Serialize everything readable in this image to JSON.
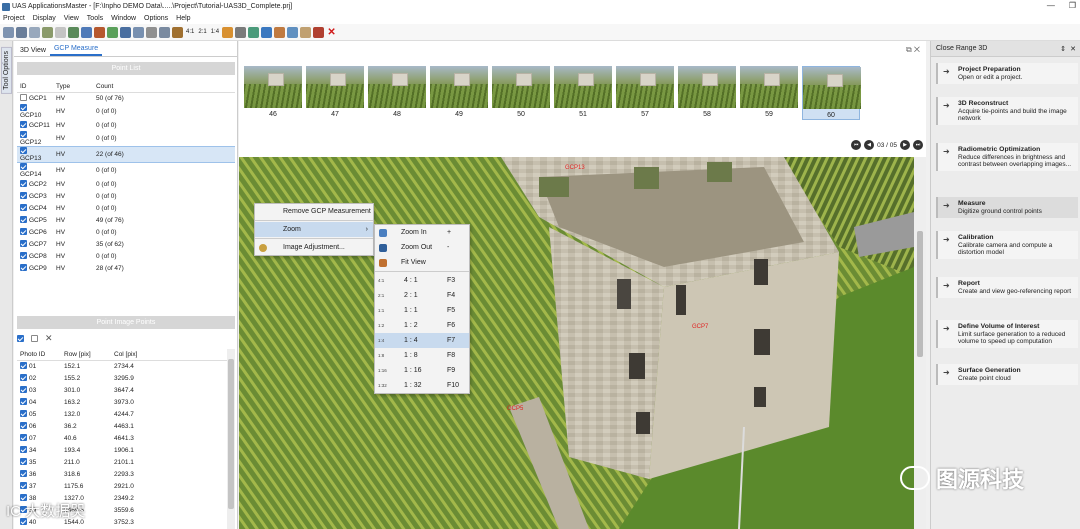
{
  "window": {
    "title": "UAS ApplicationsMaster - [F:\\Inpho DEMO Data\\.....\\Project\\Tutorial-UAS3D_Complete.prj]"
  },
  "menu": [
    "Project",
    "Display",
    "View",
    "Tools",
    "Window",
    "Options",
    "Help"
  ],
  "toolbar": {
    "ratio_labels": [
      "4:1",
      "2:1",
      "1:4"
    ]
  },
  "side_tab": "Tool Options",
  "left_tabs": [
    "3D View",
    "GCP Measure"
  ],
  "point_list": {
    "header": "Point List",
    "columns": [
      "ID",
      "Type",
      "Count"
    ],
    "rows": [
      {
        "id": "GCP1",
        "type": "HV",
        "count": "50 (of 76)",
        "checked": false
      },
      {
        "id": "GCP10",
        "type": "HV",
        "count": "0 (of 0)",
        "checked": true
      },
      {
        "id": "GCP11",
        "type": "HV",
        "count": "0 (of 0)",
        "checked": true
      },
      {
        "id": "GCP12",
        "type": "HV",
        "count": "0 (of 0)",
        "checked": true
      },
      {
        "id": "GCP13",
        "type": "HV",
        "count": "22 (of 46)",
        "checked": true,
        "selected": true
      },
      {
        "id": "GCP14",
        "type": "HV",
        "count": "0 (of 0)",
        "checked": true
      },
      {
        "id": "GCP2",
        "type": "HV",
        "count": "0 (of 0)",
        "checked": true
      },
      {
        "id": "GCP3",
        "type": "HV",
        "count": "0 (of 0)",
        "checked": true
      },
      {
        "id": "GCP4",
        "type": "HV",
        "count": "0 (of 0)",
        "checked": true
      },
      {
        "id": "GCP5",
        "type": "HV",
        "count": "49 (of 76)",
        "checked": true
      },
      {
        "id": "GCP6",
        "type": "HV",
        "count": "0 (of 0)",
        "checked": true
      },
      {
        "id": "GCP7",
        "type": "HV",
        "count": "35 (of 62)",
        "checked": true
      },
      {
        "id": "GCP8",
        "type": "HV",
        "count": "0 (of 0)",
        "checked": true
      },
      {
        "id": "GCP9",
        "type": "HV",
        "count": "28 (of 47)",
        "checked": true
      }
    ]
  },
  "image_points": {
    "header": "Point Image Points",
    "columns": [
      "Photo ID",
      "Row [pix]",
      "Col [pix]"
    ],
    "rows": [
      {
        "photo": "01",
        "row": "152.1",
        "col": "2734.4"
      },
      {
        "photo": "02",
        "row": "155.2",
        "col": "3295.9"
      },
      {
        "photo": "03",
        "row": "301.0",
        "col": "3647.4"
      },
      {
        "photo": "04",
        "row": "163.2",
        "col": "3973.0"
      },
      {
        "photo": "05",
        "row": "132.0",
        "col": "4244.7"
      },
      {
        "photo": "06",
        "row": "36.2",
        "col": "4463.1"
      },
      {
        "photo": "07",
        "row": "40.6",
        "col": "4641.3"
      },
      {
        "photo": "34",
        "row": "193.4",
        "col": "1906.1"
      },
      {
        "photo": "35",
        "row": "211.0",
        "col": "2101.1"
      },
      {
        "photo": "36",
        "row": "318.6",
        "col": "2293.3"
      },
      {
        "photo": "37",
        "row": "1175.6",
        "col": "2921.0"
      },
      {
        "photo": "38",
        "row": "1327.0",
        "col": "2349.2"
      },
      {
        "photo": "39",
        "row": "1469.6",
        "col": "3559.6"
      },
      {
        "photo": "40",
        "row": "1544.0",
        "col": "3752.3"
      }
    ]
  },
  "thumbnails": [
    "46",
    "47",
    "48",
    "49",
    "50",
    "51",
    "57",
    "58",
    "59",
    "60"
  ],
  "selected_thumbnail": "60",
  "pager": {
    "text": "03 / 05"
  },
  "main_view": {
    "gcp_labels": [
      "GCP13",
      "GCP7",
      "GCP5"
    ]
  },
  "context_menu": [
    {
      "label": "Remove GCP Measurement"
    },
    {
      "label": "Zoom",
      "submenu": true,
      "highlighted": true
    },
    {
      "label": "Image Adjustment..."
    }
  ],
  "zoom_menu": {
    "top": [
      {
        "label": "Zoom In",
        "shortcut": "+"
      },
      {
        "label": "Zoom Out",
        "shortcut": "-"
      },
      {
        "label": "Fit View",
        "shortcut": ""
      }
    ],
    "ratios": [
      {
        "icon": "4:1",
        "label": "4 : 1",
        "shortcut": "F3"
      },
      {
        "icon": "2:1",
        "label": "2 : 1",
        "shortcut": "F4"
      },
      {
        "icon": "1:1",
        "label": "1 : 1",
        "shortcut": "F5"
      },
      {
        "icon": "1:2",
        "label": "1 : 2",
        "shortcut": "F6"
      },
      {
        "icon": "1:4",
        "label": "1 : 4",
        "shortcut": "F7",
        "highlighted": true
      },
      {
        "icon": "1:8",
        "label": "1 : 8",
        "shortcut": "F8"
      },
      {
        "icon": "1:16",
        "label": "1 : 16",
        "shortcut": "F9"
      },
      {
        "icon": "1:32",
        "label": "1 : 32",
        "shortcut": "F10"
      }
    ]
  },
  "right_panel": {
    "title": "Close Range 3D",
    "steps": [
      {
        "title": "Project Preparation",
        "desc": "Open or edit a project."
      },
      {
        "title": "3D Reconstruct",
        "desc": "Acquire tie-points and build the image network"
      },
      {
        "title": "Radiometric Optimization",
        "desc": "Reduce differences in brightness and contrast between overlapping images..."
      },
      {
        "title": "Measure",
        "desc": "Digitize ground control points",
        "active": true
      },
      {
        "title": "Calibration",
        "desc": "Calibrate camera and compute a distortion model"
      },
      {
        "title": "Report",
        "desc": "Create and view geo-referencing report"
      },
      {
        "title": "Define Volume of Interest",
        "desc": "Limit surface generation to a reduced volume to speed up computation"
      },
      {
        "title": "Surface Generation",
        "desc": "Create point cloud"
      }
    ]
  },
  "watermark": {
    "text": "图源科技",
    "corner_text": "IC 大数据哭"
  },
  "colors": {
    "accent": "#2a6fc9",
    "selection": "#d7e6f6",
    "menu_highlight": "#c8daee",
    "gcp_label": "#e02020"
  }
}
